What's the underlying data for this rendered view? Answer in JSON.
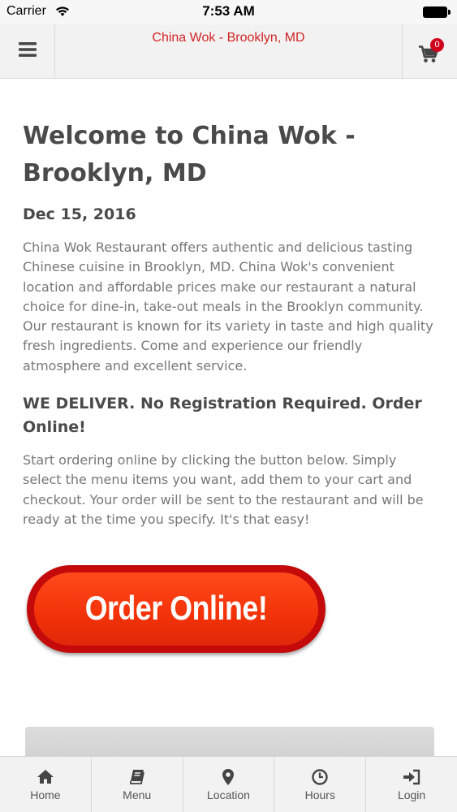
{
  "status_bar": {
    "carrier": "Carrier",
    "time": "7:53 AM"
  },
  "header": {
    "title": "China Wok - Brooklyn, MD",
    "cart_count": "0"
  },
  "main": {
    "title": "Welcome to China Wok - Brooklyn, MD",
    "date": "Dec 15, 2016",
    "intro": "China Wok Restaurant offers authentic and delicious tasting Chinese cuisine in Brooklyn, MD.  China Wok's convenient location and affordable prices make our restaurant a natural choice for dine-in, take-out meals in the Brooklyn community. Our restaurant is known for its variety in taste and high quality fresh ingredients. Come and experience our friendly atmosphere and excellent service.",
    "delivery_heading": "WE DELIVER. No Registration Required. Order Online!",
    "ordering_text": "Start ordering online by clicking the button below. Simply select the menu items you want, add them to your cart and checkout. Your order will be sent to the restaurant and will be ready at the time you specify. It's that easy!",
    "order_button_label": "Order Online!"
  },
  "tabs": [
    {
      "label": "Home",
      "icon": "home-icon"
    },
    {
      "label": "Menu",
      "icon": "book-icon"
    },
    {
      "label": "Location",
      "icon": "map-marker-icon"
    },
    {
      "label": "Hours",
      "icon": "clock-icon"
    },
    {
      "label": "Login",
      "icon": "sign-in-icon"
    }
  ],
  "colors": {
    "brand_red": "#d22525",
    "order_button": "#f23208",
    "badge": "#d0021b"
  }
}
